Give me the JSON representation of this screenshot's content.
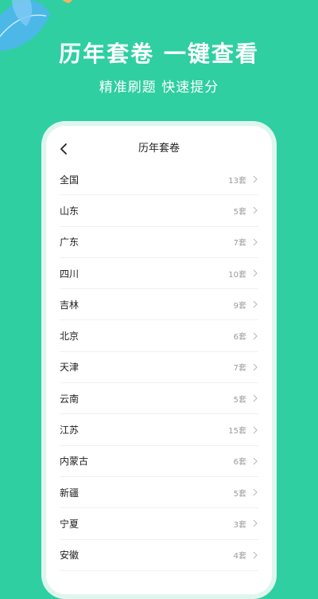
{
  "headline": "历年套卷  一键查看",
  "subline": "精准刷题  快速提分",
  "colors": {
    "background": "#2fcfa2",
    "phone_frame": "#dff6ef",
    "count_text": "#9a9a9a",
    "leaf_blue": "#4fb5f0",
    "leaf_orange": "#f5b45f"
  },
  "nav": {
    "back_icon": "chevron-left-icon",
    "title": "历年套卷"
  },
  "list": {
    "chevron_icon": "chevron-right-icon",
    "items": [
      {
        "name": "全国",
        "count": "13套"
      },
      {
        "name": "山东",
        "count": "5套"
      },
      {
        "name": "广东",
        "count": "7套"
      },
      {
        "name": "四川",
        "count": "10套"
      },
      {
        "name": "吉林",
        "count": "9套"
      },
      {
        "name": "北京",
        "count": "6套"
      },
      {
        "name": "天津",
        "count": "7套"
      },
      {
        "name": "云南",
        "count": "5套"
      },
      {
        "name": "江苏",
        "count": "15套"
      },
      {
        "name": "内蒙古",
        "count": "6套"
      },
      {
        "name": "新疆",
        "count": "5套"
      },
      {
        "name": "宁夏",
        "count": "3套"
      },
      {
        "name": "安徽",
        "count": "4套"
      }
    ]
  }
}
